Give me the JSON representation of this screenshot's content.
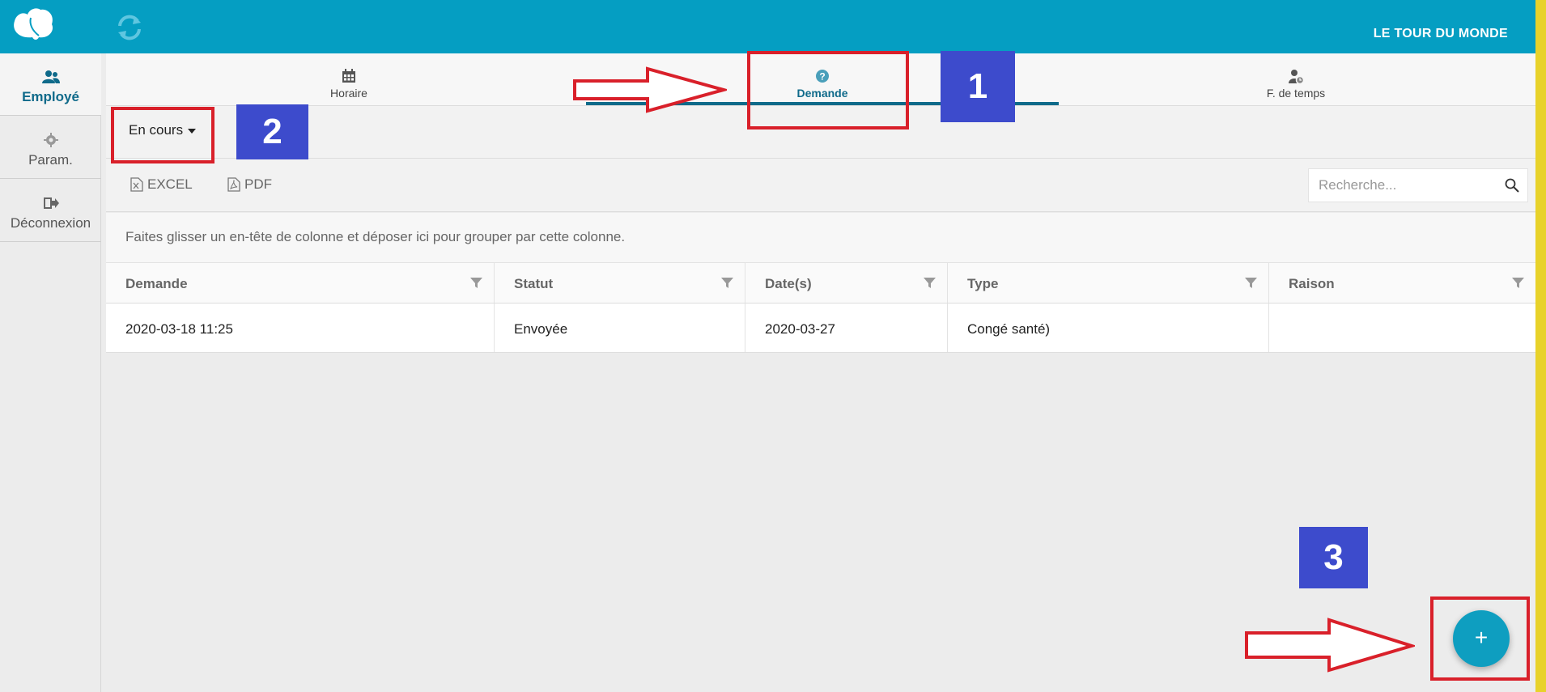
{
  "header": {
    "company": "LE TOUR DU MONDE",
    "bg_color": "#059ec2",
    "logo_icon": "butterfly-logo-icon",
    "refresh_icon": "refresh-icon"
  },
  "sidebar": {
    "items": [
      {
        "label": "Employé",
        "icon": "users-icon",
        "active": true
      },
      {
        "label": "Param.",
        "icon": "gear-icon",
        "active": false
      },
      {
        "label": "Déconnexion",
        "icon": "sign-out-icon",
        "active": false
      }
    ]
  },
  "tabs": [
    {
      "label": "Horaire",
      "icon": "calendar-icon",
      "active": false
    },
    {
      "label": "Demande",
      "icon": "question-icon",
      "active": true
    },
    {
      "label": "F. de temps",
      "icon": "user-clock-icon",
      "active": false
    }
  ],
  "filter": {
    "selected": "En cours"
  },
  "toolbar": {
    "excel_label": "EXCEL",
    "pdf_label": "PDF",
    "search_placeholder": "Recherche..."
  },
  "grid": {
    "group_hint": "Faites glisser un en-tête de colonne et déposer ici pour grouper par cette colonne.",
    "columns": [
      "Demande",
      "Statut",
      "Date(s)",
      "Type",
      "Raison"
    ],
    "rows": [
      [
        "2020-03-18 11:25",
        "Envoyée",
        "2020-03-27",
        "Congé santé)",
        ""
      ]
    ]
  },
  "fab": {
    "label": "+"
  },
  "annotations": {
    "box_color": "#d9202a",
    "badge_color": "#3d4bcc",
    "numbers": [
      "1",
      "2",
      "3"
    ]
  }
}
